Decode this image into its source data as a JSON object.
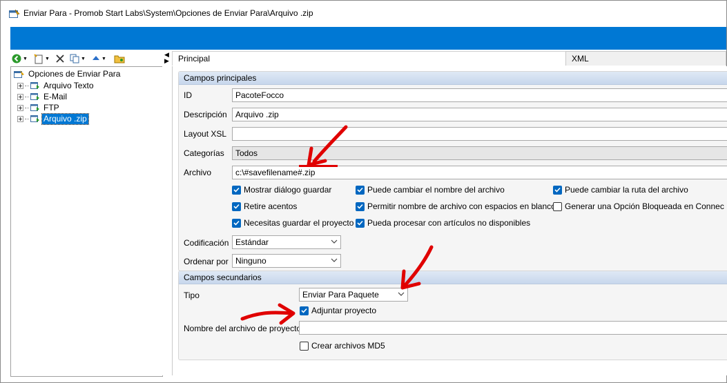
{
  "window": {
    "title": "Enviar Para - Promob Start Labs\\System\\Opciones de Enviar Para\\Arquivo .zip"
  },
  "tree": {
    "root": "Opciones de Enviar Para",
    "items": [
      {
        "label": "Arquivo Texto"
      },
      {
        "label": "E-Mail"
      },
      {
        "label": "FTP"
      },
      {
        "label": "Arquivo .zip"
      }
    ]
  },
  "tabs": [
    {
      "label": "Principal"
    },
    {
      "label": "XML"
    }
  ],
  "principal": {
    "header": "Campos principales",
    "id_label": "ID",
    "id_value": "PacoteFocco",
    "descripcion_label": "Descripción",
    "descripcion_value": "Arquivo .zip",
    "layout_label": "Layout XSL",
    "layout_value": "",
    "categorias_label": "Categorías",
    "categorias_value": "Todos",
    "archivo_label": "Archivo",
    "archivo_value": "c:\\#savefilename#.zip",
    "checkboxes": [
      {
        "label": "Mostrar diálogo guardar",
        "checked": true
      },
      {
        "label": "Puede cambiar el nombre del archivo",
        "checked": true
      },
      {
        "label": "Puede cambiar la ruta del archivo",
        "checked": true
      },
      {
        "label": "Retire acentos",
        "checked": true
      },
      {
        "label": "Permitir nombre de archivo con espacios en blanco",
        "checked": true
      },
      {
        "label": "Generar una Opción Bloqueada en Connec",
        "checked": false
      },
      {
        "label": "Necesitas guardar el proyecto",
        "checked": true
      },
      {
        "label": "Pueda procesar con artículos no disponibles",
        "checked": true
      }
    ],
    "codificacion_label": "Codificación",
    "codificacion_value": "Estándar",
    "ordenar_label": "Ordenar por",
    "ordenar_value": "Ninguno"
  },
  "secundarios": {
    "header": "Campos secundarios",
    "tipo_label": "Tipo",
    "tipo_value": "Enviar Para Paquete",
    "adjuntar_label": "Adjuntar proyecto",
    "adjuntar_checked": true,
    "nombre_label": "Nombre del archivo de proyecto",
    "nombre_value": "",
    "md5_label": "Crear archivos MD5",
    "md5_checked": false
  },
  "colors": {
    "accent_blue": "#0078d4",
    "checkbox_blue": "#0067c0",
    "annotation_red": "#e00000"
  }
}
